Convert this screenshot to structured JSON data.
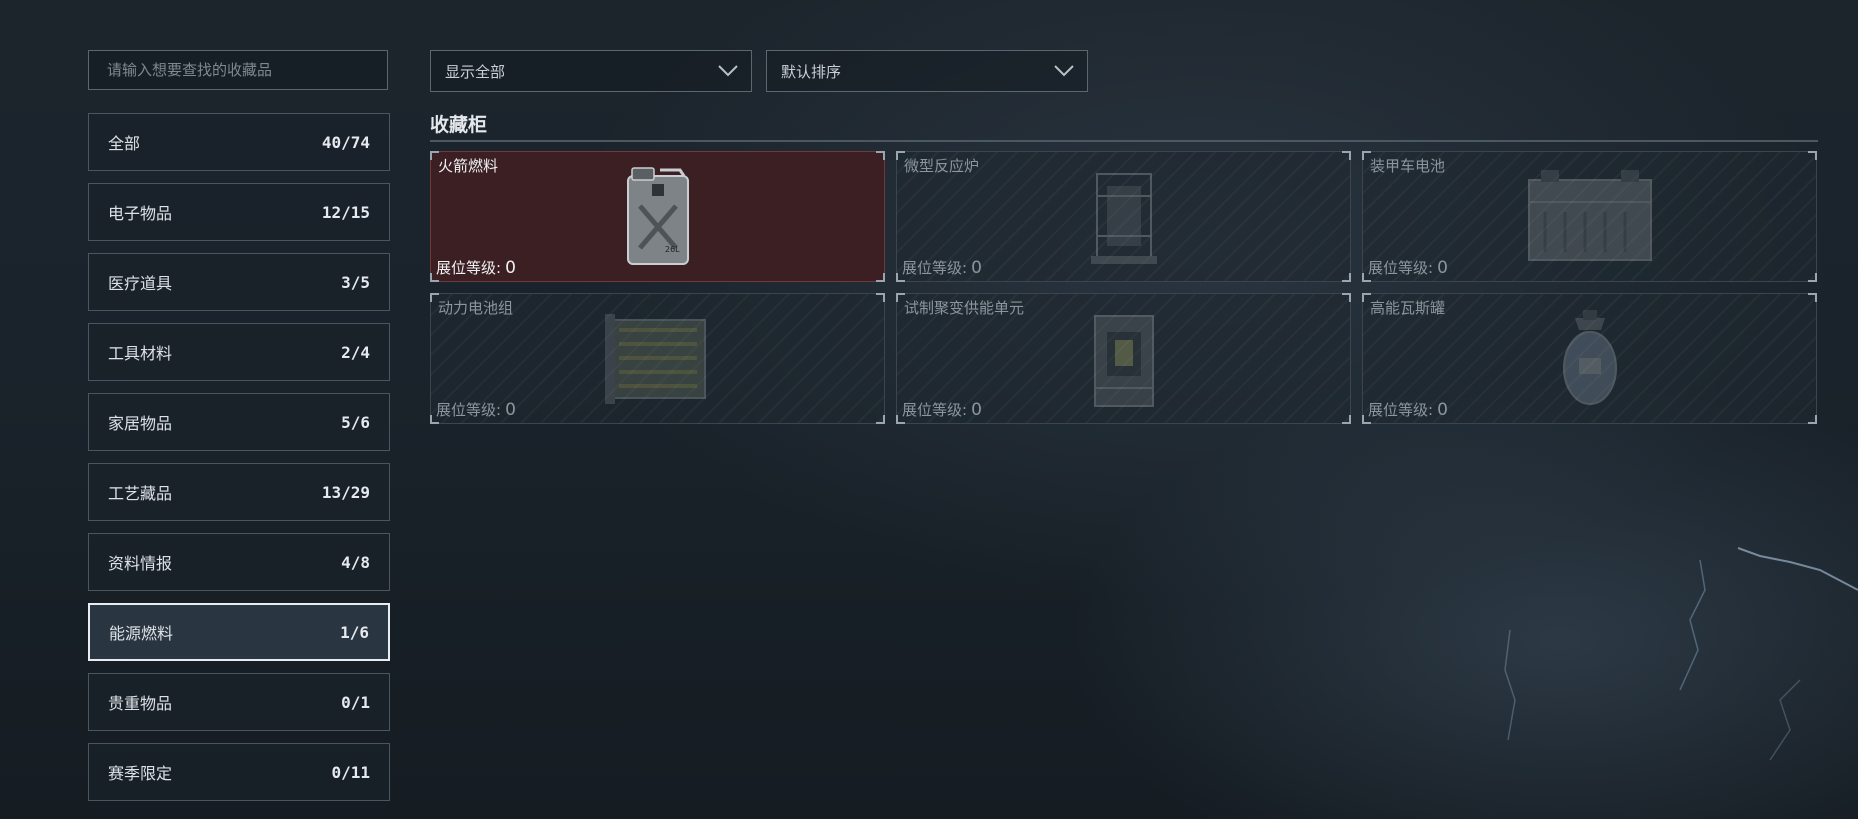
{
  "search": {
    "placeholder": "请输入想要查找的收藏品"
  },
  "categories": [
    {
      "label": "全部",
      "count": "40/74"
    },
    {
      "label": "电子物品",
      "count": "12/15"
    },
    {
      "label": "医疗道具",
      "count": "3/5"
    },
    {
      "label": "工具材料",
      "count": "2/4"
    },
    {
      "label": "家居物品",
      "count": "5/6"
    },
    {
      "label": "工艺藏品",
      "count": "13/29"
    },
    {
      "label": "资料情报",
      "count": "4/8"
    },
    {
      "label": "能源燃料",
      "count": "1/6",
      "active": true
    },
    {
      "label": "贵重物品",
      "count": "0/1"
    },
    {
      "label": "赛季限定",
      "count": "0/11"
    }
  ],
  "filters": {
    "display": {
      "selected": "显示全部"
    },
    "sort": {
      "selected": "默认排序"
    }
  },
  "section": {
    "title": "收藏柜"
  },
  "level_label": "展位等级:",
  "items": [
    {
      "name": "火箭燃料",
      "level": "0",
      "owned": true,
      "icon": "fuel-canister-icon"
    },
    {
      "name": "微型反应炉",
      "level": "0",
      "owned": false,
      "icon": "micro-reactor-icon"
    },
    {
      "name": "装甲车电池",
      "level": "0",
      "owned": false,
      "icon": "vehicle-battery-icon"
    },
    {
      "name": "动力电池组",
      "level": "0",
      "owned": false,
      "icon": "battery-pack-icon"
    },
    {
      "name": "试制聚变供能单元",
      "level": "0",
      "owned": false,
      "icon": "fusion-unit-icon"
    },
    {
      "name": "高能瓦斯罐",
      "level": "0",
      "owned": false,
      "icon": "gas-canister-icon"
    }
  ],
  "colors": {
    "owned_card": "#3b1f22",
    "active_border": "#e9edf0",
    "background": "#1a232b"
  }
}
